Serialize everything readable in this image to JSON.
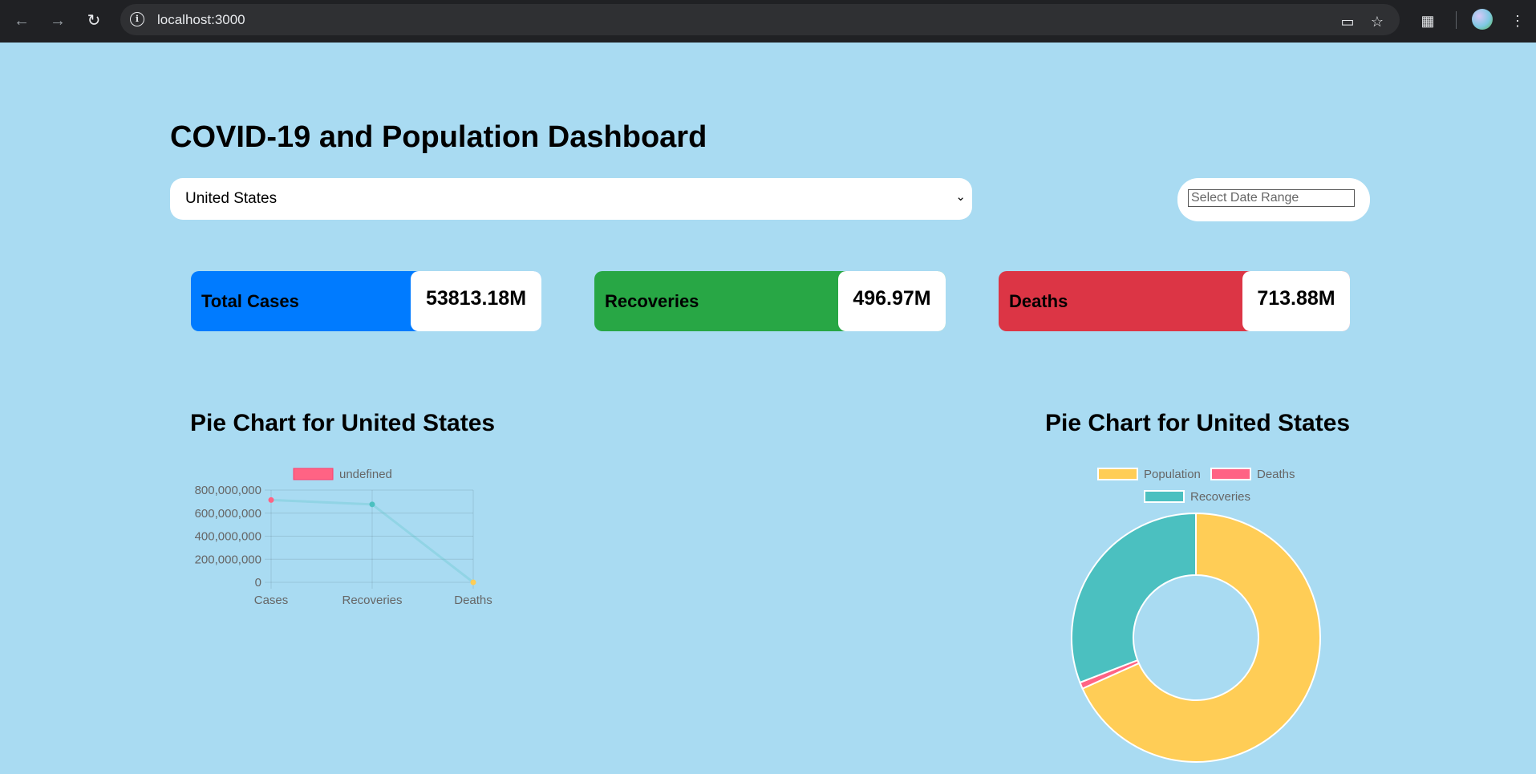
{
  "browser": {
    "url": "localhost:3000"
  },
  "page": {
    "title": "COVID-19 and Population Dashboard"
  },
  "filters": {
    "country_selected": "United States",
    "date_placeholder": "Select Date Range"
  },
  "stats": {
    "cases_label": "Total Cases",
    "cases_value": "53813.18M",
    "recoveries_label": "Recoveries",
    "recoveries_value": "496.97M",
    "deaths_label": "Deaths",
    "deaths_value": "713.88M"
  },
  "colors": {
    "cases": "#007bff",
    "recoveries": "#28a745",
    "deaths": "#dc3545",
    "pink": "#ff6384",
    "teal": "#4bc0c0",
    "yellow": "#ffcd56"
  },
  "charts": {
    "left_title": "Pie Chart for United States",
    "right_title": "Pie Chart for United States"
  },
  "chart_data": [
    {
      "type": "line",
      "title": "Pie Chart for United States",
      "legend": [
        "undefined"
      ],
      "categories": [
        "Cases",
        "Recoveries",
        "Deaths"
      ],
      "values": [
        713880000,
        676000000,
        0
      ],
      "ylim": [
        0,
        800000000
      ],
      "yticks": [
        "800,000,000",
        "600,000,000",
        "400,000,000",
        "200,000,000",
        "0"
      ],
      "point_colors": [
        "#ff6384",
        "#4bc0c0",
        "#ffcd56"
      ],
      "grid": true
    },
    {
      "type": "pie",
      "title": "Pie Chart for United States",
      "labels": [
        "Population",
        "Deaths",
        "Recoveries"
      ],
      "values": [
        1535,
        19,
        694
      ],
      "colors": [
        "#ffcd56",
        "#ff6384",
        "#4bc0c0"
      ],
      "legend_position": "top"
    }
  ]
}
